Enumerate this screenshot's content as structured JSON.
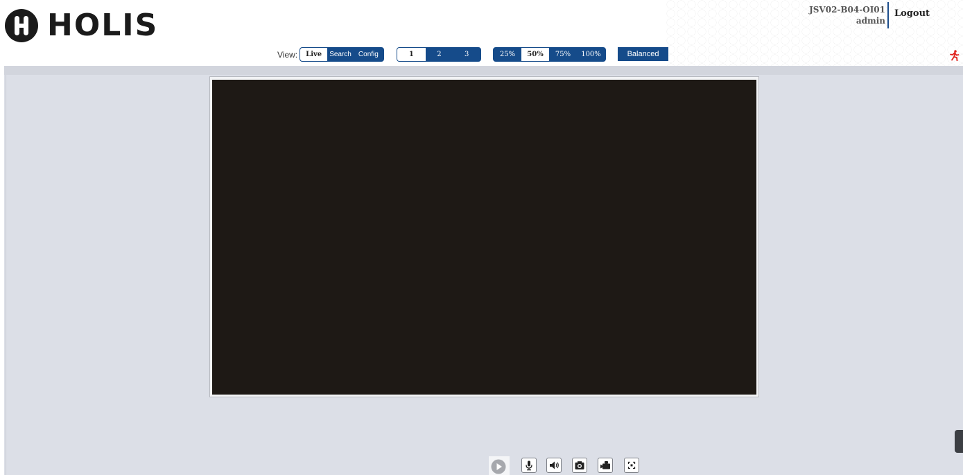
{
  "brand": {
    "name": "HOLIS",
    "mark": "H"
  },
  "device": {
    "name": "JSV02-B04-OI01",
    "user": "admin"
  },
  "header": {
    "logout_label": "Logout"
  },
  "toolbar": {
    "view_label": "View:",
    "view_tabs": [
      "Live",
      "Search",
      "Config"
    ],
    "active_view": "Live",
    "streams": [
      "1",
      "2",
      "3"
    ],
    "active_stream": "1",
    "zoom_levels": [
      "25%",
      "50%",
      "75%",
      "100%"
    ],
    "active_zoom": "50%",
    "quality_label": "Balanced"
  },
  "controls": {
    "icons": [
      "play-icon",
      "microphone-icon",
      "speaker-icon",
      "snapshot-icon",
      "record-icon",
      "fullscreen-icon"
    ]
  },
  "colors": {
    "accent": "#154b8a",
    "video_bg": "#1e1915",
    "content_bg": "#dcdfe7",
    "alarm": "#e0201b"
  }
}
